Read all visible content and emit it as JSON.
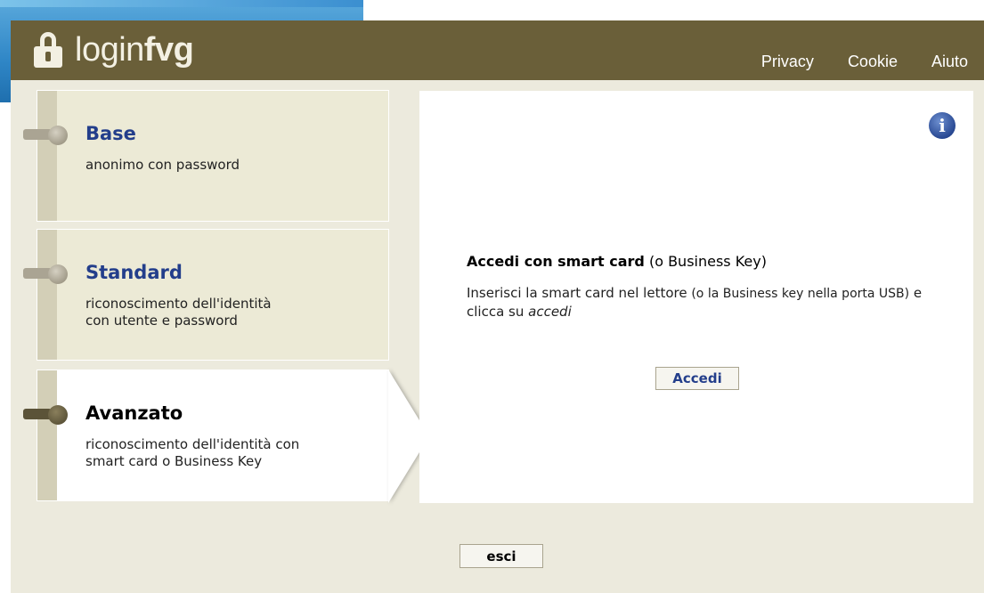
{
  "header": {
    "logo_light": "login",
    "logo_bold": "fvg",
    "nav": [
      "Privacy",
      "Cookie",
      "Aiuto"
    ]
  },
  "levels": [
    {
      "title": "Base",
      "desc_lines": [
        "anonimo con password"
      ]
    },
    {
      "title": "Standard",
      "desc_lines": [
        "riconoscimento dell'identità",
        "con utente e password"
      ]
    },
    {
      "title": "Avanzato",
      "desc_lines": [
        "riconoscimento dell'identità con",
        "smart card o Business Key"
      ]
    }
  ],
  "active_level": "Avanzato",
  "panel": {
    "title_bold": "Accedi con smart card",
    "title_rest": " (o Business Key)",
    "text_part1": "Inserisci la smart card nel lettore ",
    "text_small": "(o la Business key nella porta USB)",
    "text_part2": " e clicca su ",
    "text_italic": "accedi",
    "accedi_label": "Accedi"
  },
  "exit_label": "esci",
  "colors": {
    "header_bg": "#6a5f39",
    "page_bg": "#eceadd",
    "title_blue": "#233e8b"
  }
}
